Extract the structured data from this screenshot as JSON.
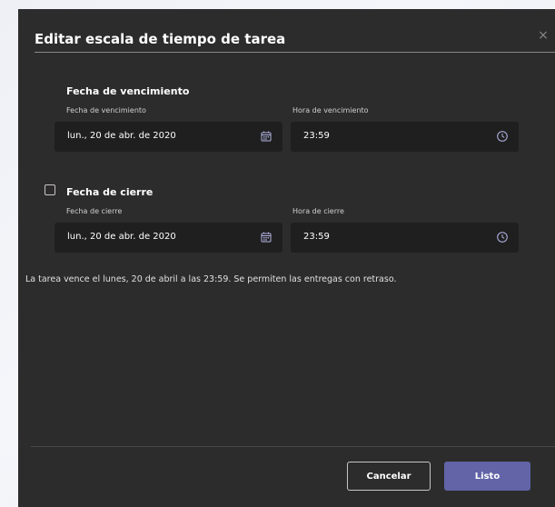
{
  "dialog": {
    "title": "Editar escala de tiempo de tarea",
    "close_glyph": "×"
  },
  "due": {
    "section_title": "Fecha de vencimiento",
    "date_label": "Fecha de vencimiento",
    "date_value": "lun., 20 de abr. de 2020",
    "time_label": "Hora de vencimiento",
    "time_value": "23:59"
  },
  "close": {
    "section_title": "Fecha de cierre",
    "checked": false,
    "date_label": "Fecha de cierre",
    "date_value": "lun., 20 de abr. de 2020",
    "time_label": "Hora de cierre",
    "time_value": "23:59"
  },
  "summary": "La tarea vence el lunes, 20 de abril a las 23:59. Se permiten las entregas con retraso.",
  "footer": {
    "cancel_label": "Cancelar",
    "done_label": "Listo"
  },
  "colors": {
    "dialog_bg": "#2d2c2c",
    "field_bg": "#1f1f1f",
    "accent": "#6264a7",
    "icon": "#b4b6e6"
  },
  "icons": {
    "date": "calendar-icon",
    "time": "clock-icon",
    "close": "close-icon"
  }
}
